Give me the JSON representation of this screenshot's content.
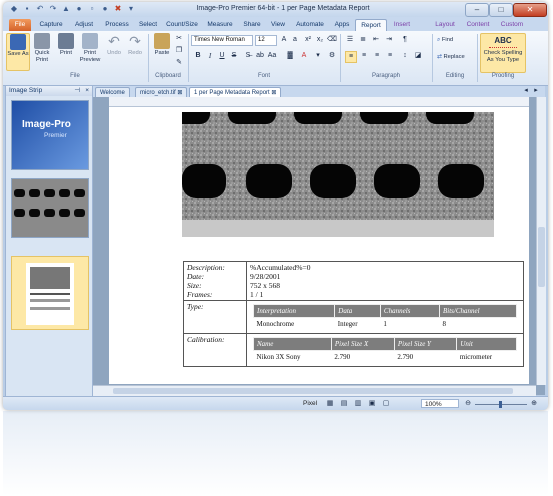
{
  "window": {
    "title": "Image-Pro Premier 64-bit - 1 per Page Metadata Report",
    "controls": [
      "–",
      "□",
      "✕"
    ]
  },
  "ribbon_tabs": [
    "File",
    "Capture",
    "Adjust",
    "Process",
    "Select",
    "Count/Size",
    "Measure",
    "Share",
    "View",
    "Automate",
    "Apps",
    "Report",
    "Insert",
    "Layout",
    "Content",
    "Custom"
  ],
  "ribbon": {
    "file_group": {
      "label": "File",
      "buttons": [
        "Save As",
        "Quick Print",
        "Print",
        "Print Preview",
        "Undo",
        "Redo"
      ]
    },
    "clipboard_group": {
      "label": "Clipboard",
      "paste": "Paste"
    },
    "font_group": {
      "label": "Font",
      "font_name": "Times New Roman",
      "font_size": "12"
    },
    "paragraph_group": {
      "label": "Paragraph"
    },
    "editing_group": {
      "label": "Editing",
      "find": "Find",
      "replace": "Replace"
    },
    "proofing_group": {
      "label": "Proofing",
      "spell_icon_text": "ABC",
      "spell_button": "Check Spelling As You Type"
    }
  },
  "image_strip": {
    "title": "Image Strip",
    "thumb_logo_line1": "Image-Pro",
    "thumb_logo_line2": "Premier"
  },
  "doc_tabs": [
    "Welcome",
    "micro_etch.tif",
    "1 per Page Metadata Report"
  ],
  "report": {
    "description_label": "Description:",
    "description_value": "%Accumulated%=0",
    "date_label": "Date:",
    "date_value": "9/28/2001",
    "size_label": "Size:",
    "size_value": "752 x 568",
    "frames_label": "Frames:",
    "frames_value": "1 / 1",
    "type_label": "Type:",
    "type_headers": [
      "Interpretation",
      "Data",
      "Channels",
      "Bits/Channel"
    ],
    "type_values": [
      "Monochrome",
      "Integer",
      "1",
      "8"
    ],
    "calibration_label": "Calibration:",
    "calibration_headers": [
      "Name",
      "Pixel Size X",
      "Pixel Size Y",
      "Unit"
    ],
    "calibration_values": [
      "Nikon 3X Sony",
      "2.790",
      "2.790",
      "micrometer"
    ]
  },
  "status": {
    "unit": "Pixel",
    "zoom": "100%"
  },
  "colors": {
    "file_tab": "#d5632a",
    "ribbon_bg": "#dbe6f4",
    "frame": "#b9cde6"
  }
}
